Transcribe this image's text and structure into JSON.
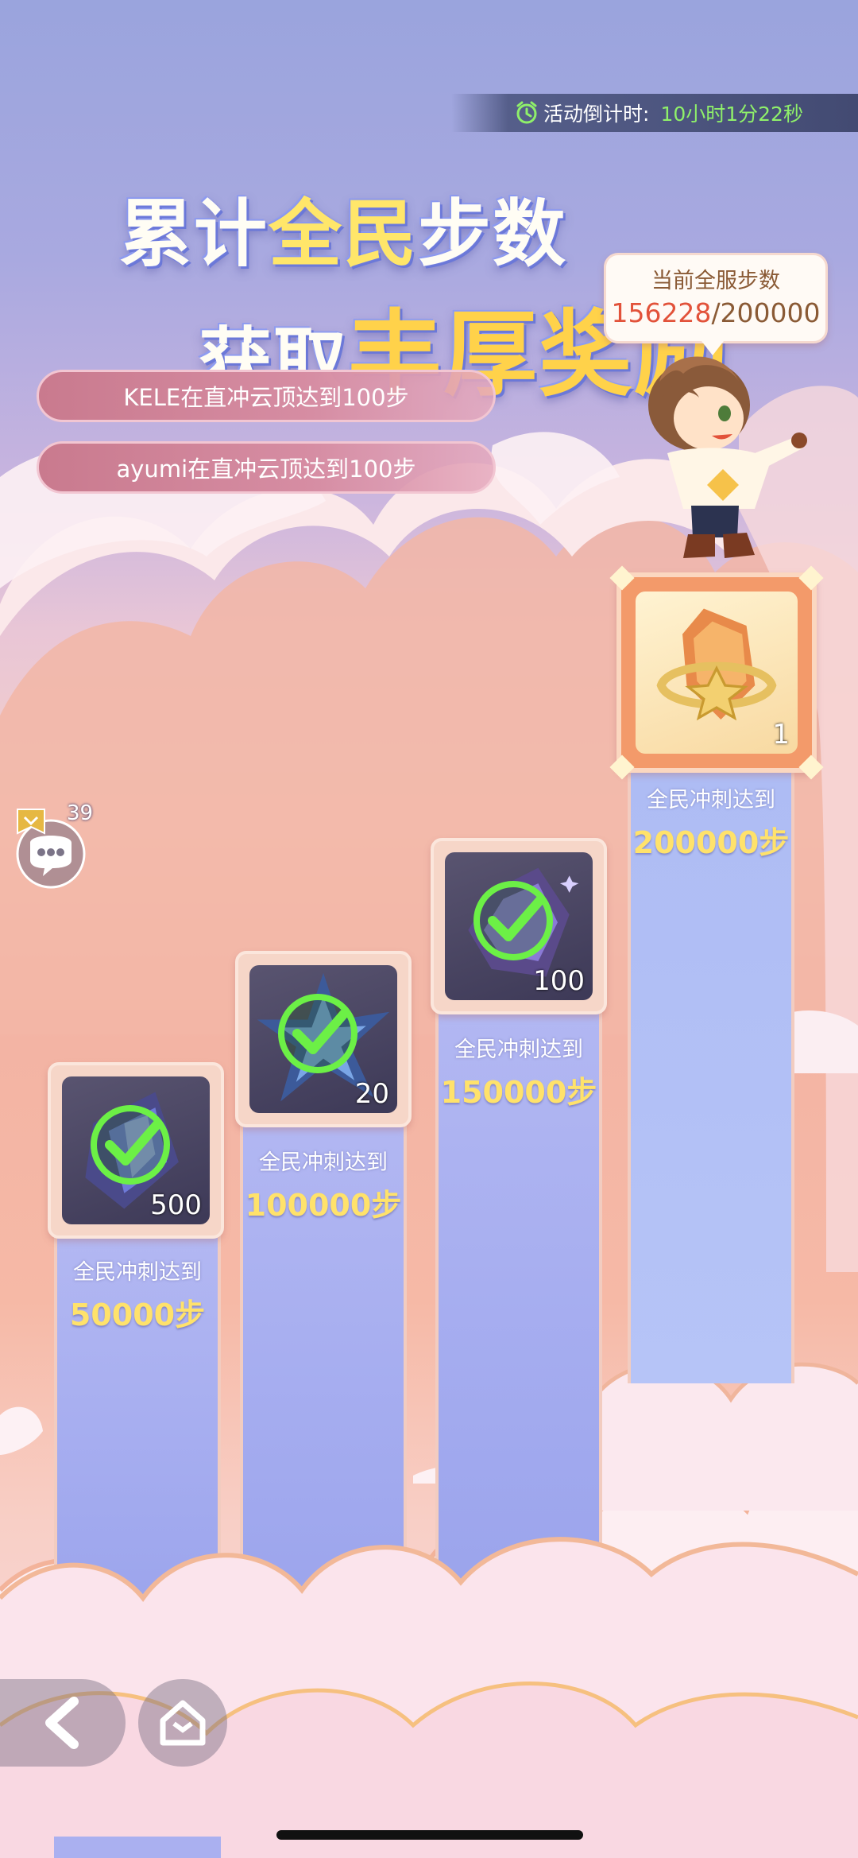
{
  "countdown": {
    "label": "活动倒计时:",
    "value": "10小时1分22秒"
  },
  "headline": {
    "line1_a": "累计",
    "line1_b": "全民",
    "line1_c": "步数",
    "line2_a": "获取",
    "line2_b": "丰厚",
    "line2_c": "奖励"
  },
  "server_steps": {
    "label": "当前全服步数",
    "current": "156228",
    "goal": "/200000"
  },
  "broadcasts": [
    {
      "text": "KELE在直冲云顶达到100步"
    },
    {
      "text": "ayumi在直冲云顶达到100步"
    }
  ],
  "chat": {
    "count": "39"
  },
  "milestones": [
    {
      "label": "全民冲刺达到",
      "steps": "50000步",
      "qty": "500",
      "claimed": true,
      "item": "purple-crystal"
    },
    {
      "label": "全民冲刺达到",
      "steps": "100000步",
      "qty": "20",
      "claimed": true,
      "item": "blue-star-crystal"
    },
    {
      "label": "全民冲刺达到",
      "steps": "150000步",
      "qty": "100",
      "claimed": true,
      "item": "violet-crystal"
    },
    {
      "label": "全民冲刺达到",
      "steps": "200000步",
      "qty": "1",
      "claimed": false,
      "item": "golden-crystal"
    }
  ],
  "colors": {
    "accent_gold": "#ffe26b",
    "check_green": "#6cf046",
    "progress_red": "#e2523a",
    "countdown_green": "#8ff06a"
  }
}
